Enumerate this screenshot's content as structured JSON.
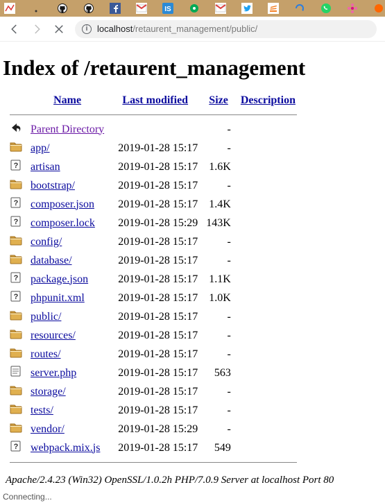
{
  "browser": {
    "tabs": [
      {
        "icon": "chart"
      },
      {
        "icon": "dot"
      },
      {
        "icon": "github"
      },
      {
        "icon": "github"
      },
      {
        "icon": "facebook"
      },
      {
        "icon": "gmail"
      },
      {
        "icon": "isquare"
      },
      {
        "icon": "circle-dot"
      },
      {
        "icon": "gmail"
      },
      {
        "icon": "twitter"
      },
      {
        "icon": "stack"
      },
      {
        "icon": "refresh"
      },
      {
        "icon": "whatsapp"
      },
      {
        "icon": "flower"
      },
      {
        "icon": "orange"
      }
    ],
    "url_host": "localhost",
    "url_path": "/retaurent_management/public/",
    "info_glyph": "i",
    "status": "Connecting..."
  },
  "page": {
    "title": "Index of /retaurent_management",
    "headers": {
      "name": "Name",
      "last_modified": "Last modified",
      "size": "Size",
      "description": "Description"
    },
    "entries": [
      {
        "icon": "back",
        "name": "Parent Directory",
        "date": "",
        "size": "-",
        "visited": true
      },
      {
        "icon": "folder",
        "name": "app/",
        "date": "2019-01-28 15:17",
        "size": "-"
      },
      {
        "icon": "file",
        "name": "artisan",
        "date": "2019-01-28 15:17",
        "size": "1.6K"
      },
      {
        "icon": "folder",
        "name": "bootstrap/",
        "date": "2019-01-28 15:17",
        "size": "-"
      },
      {
        "icon": "file",
        "name": "composer.json",
        "date": "2019-01-28 15:17",
        "size": "1.4K"
      },
      {
        "icon": "file",
        "name": "composer.lock",
        "date": "2019-01-28 15:29",
        "size": "143K"
      },
      {
        "icon": "folder",
        "name": "config/",
        "date": "2019-01-28 15:17",
        "size": "-"
      },
      {
        "icon": "folder",
        "name": "database/",
        "date": "2019-01-28 15:17",
        "size": "-"
      },
      {
        "icon": "file",
        "name": "package.json",
        "date": "2019-01-28 15:17",
        "size": "1.1K"
      },
      {
        "icon": "file",
        "name": "phpunit.xml",
        "date": "2019-01-28 15:17",
        "size": "1.0K"
      },
      {
        "icon": "folder",
        "name": "public/",
        "date": "2019-01-28 15:17",
        "size": "-"
      },
      {
        "icon": "folder",
        "name": "resources/",
        "date": "2019-01-28 15:17",
        "size": "-"
      },
      {
        "icon": "folder",
        "name": "routes/",
        "date": "2019-01-28 15:17",
        "size": "-"
      },
      {
        "icon": "text",
        "name": "server.php",
        "date": "2019-01-28 15:17",
        "size": "563"
      },
      {
        "icon": "folder",
        "name": "storage/",
        "date": "2019-01-28 15:17",
        "size": "-"
      },
      {
        "icon": "folder",
        "name": "tests/",
        "date": "2019-01-28 15:17",
        "size": "-"
      },
      {
        "icon": "folder",
        "name": "vendor/",
        "date": "2019-01-28 15:29",
        "size": "-"
      },
      {
        "icon": "file",
        "name": "webpack.mix.js",
        "date": "2019-01-28 15:17",
        "size": "549"
      }
    ],
    "server_signature": "Apache/2.4.23 (Win32) OpenSSL/1.0.2h PHP/7.0.9 Server at localhost Port 80"
  }
}
